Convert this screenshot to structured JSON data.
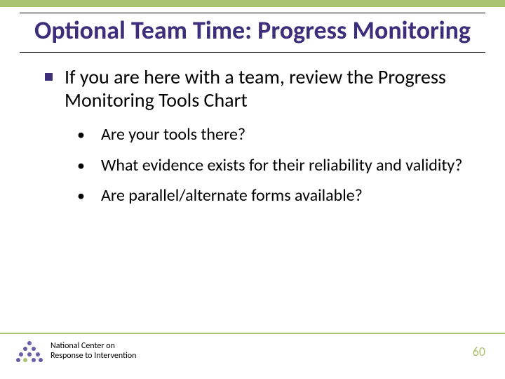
{
  "colors": {
    "accent_green": "#a8c270",
    "title_purple": "#3c2e7a"
  },
  "title": "Optional Team Time: Progress Monitoring",
  "main_bullet": "If you are here with a team, review the Progress Monitoring Tools Chart",
  "sub_bullets": [
    "Are your tools there?",
    "What evidence exists for their reliability and validity?",
    "Are parallel/alternate forms available?"
  ],
  "footer": {
    "org_line1": "National Center on",
    "org_line2": "Response to Intervention",
    "page_number": "60"
  }
}
